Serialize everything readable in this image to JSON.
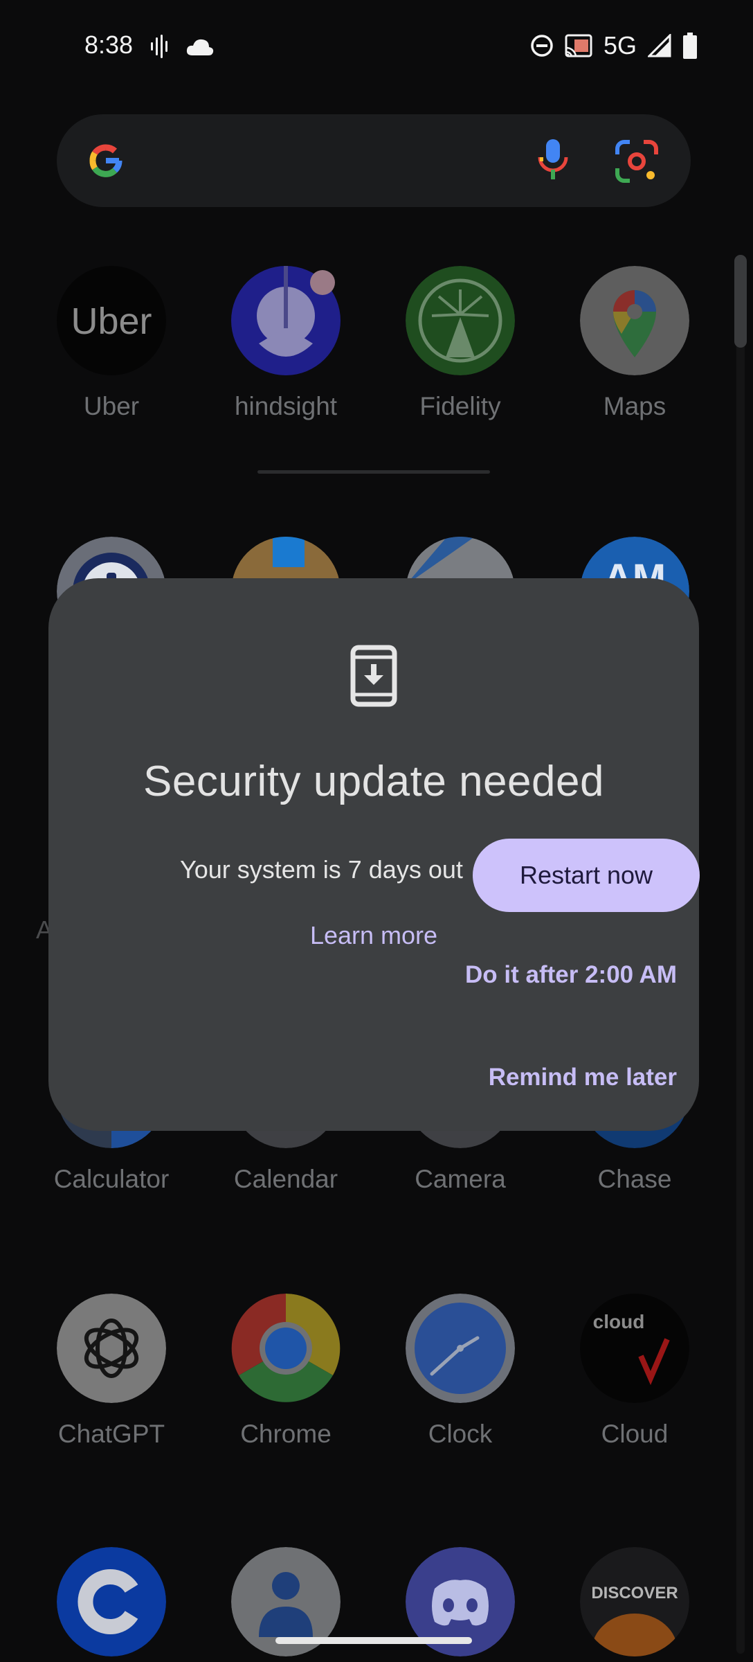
{
  "status_bar": {
    "time": "8:38",
    "network": "5G",
    "icons": [
      "voicemail-wave-icon",
      "cloud-icon",
      "do-not-disturb-icon",
      "cast-icon",
      "signal-icon",
      "battery-icon"
    ]
  },
  "search": {
    "icons": [
      "google-g-icon",
      "microphone-icon",
      "google-lens-icon"
    ]
  },
  "apps": {
    "row1": [
      "Uber",
      "hindsight",
      "Fidelity",
      "Maps"
    ],
    "row3": [
      "Calculator",
      "Calendar",
      "Camera",
      "Chase"
    ],
    "row4": [
      "ChatGPT",
      "Chrome",
      "Clock",
      "Cloud"
    ],
    "uber_logo": "Uber",
    "cloud_logo": "cloud",
    "discover_logo": "DISCOVER",
    "amex_logo": "AM"
  },
  "side_letter": "A",
  "dialog": {
    "title": "Security update needed",
    "body": "Your system is 7 days out",
    "learn_more": "Learn more",
    "restart_button": "Restart now",
    "later_button": "Do it after 2:00 AM",
    "remind_button": "Remind me later"
  },
  "colors": {
    "accent": "#cdc2fb",
    "accent_text": "#c7bdf5",
    "dialog_bg": "#3d3f41",
    "screen_bg": "#0b0b0c"
  }
}
